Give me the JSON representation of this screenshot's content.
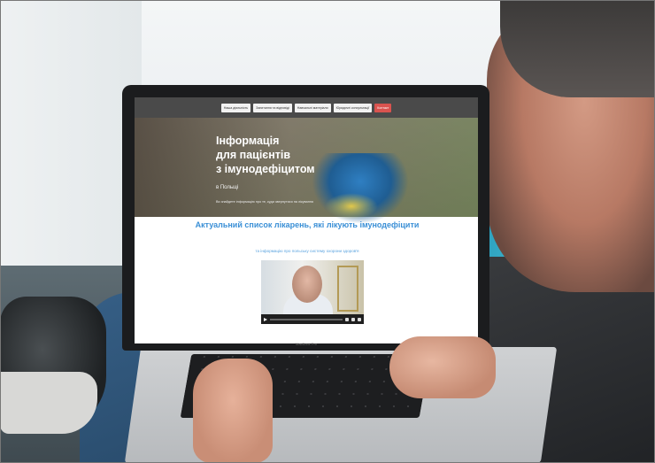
{
  "nav": {
    "items": [
      {
        "label": "Наша діяльність",
        "accent": false
      },
      {
        "label": "Запитання та відповіді",
        "accent": false
      },
      {
        "label": "Навчальні матеріали",
        "accent": false
      },
      {
        "label": "Юридичні консультації",
        "accent": false
      },
      {
        "label": "Контакт",
        "accent": true
      }
    ]
  },
  "hero": {
    "title_line1": "Інформація",
    "title_line2": "для пацієнтів",
    "title_line3": "з імунодефіцитом",
    "subtitle": "в Польщі",
    "description": "Ви знайдете інформацію про те, куди звернутися на лікування"
  },
  "section": {
    "title": "Актуальний список лікарень, які лікують імунодефіцити",
    "subtitle": "та інформацію про польську систему охорони здоров'я"
  },
  "laptop": {
    "brand": "MacBook Pro"
  },
  "colors": {
    "accent_blue": "#3a8fd6",
    "nav_bg": "#4a4a4a",
    "contact_red": "#d9534f"
  }
}
